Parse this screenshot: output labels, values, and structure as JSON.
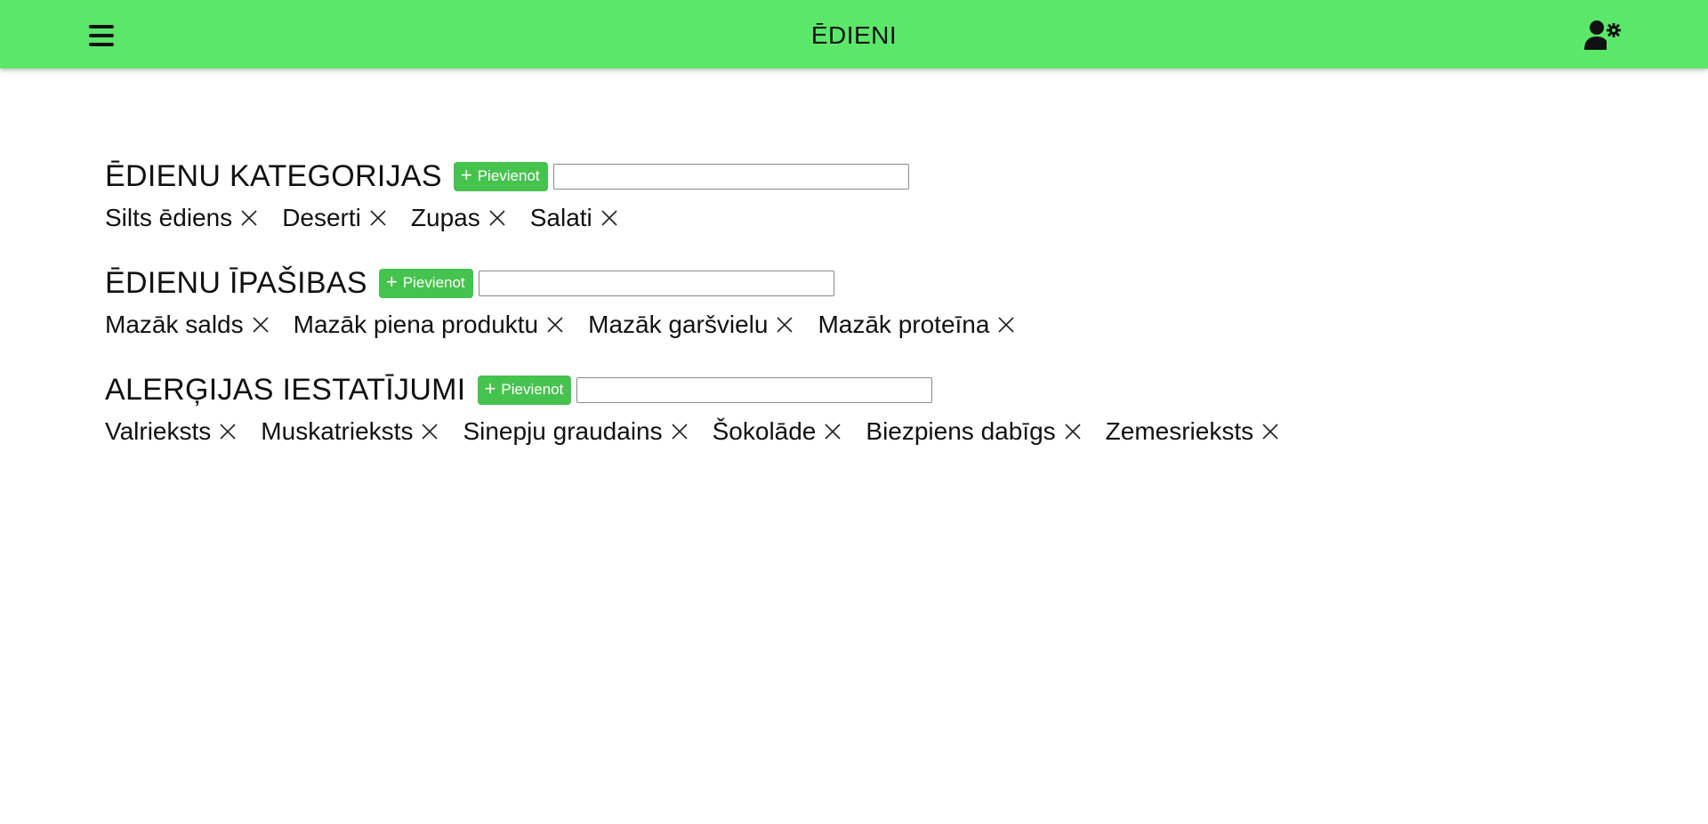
{
  "header": {
    "title": "ĒDIENI",
    "menu_icon": "hamburger-menu-icon",
    "user_icon": "user-settings-icon",
    "background_color": "#5be86a"
  },
  "add_button_label": "Pievienot",
  "sections": [
    {
      "title": "ĒDIENU KATEGORIJAS",
      "input_value": "",
      "tags": [
        "Silts ēdiens",
        "Deserti",
        "Zupas",
        "Salati"
      ]
    },
    {
      "title": "ĒDIENU ĪPAŠIBAS",
      "input_value": "",
      "tags": [
        "Mazāk salds",
        "Mazāk piena produktu",
        "Mazāk garšvielu",
        "Mazāk proteīna"
      ]
    },
    {
      "title": "ALERĢIJAS IESTATĪJUMI",
      "input_value": "",
      "tags": [
        "Valrieksts",
        "Muskatrieksts",
        "Sinepju graudains",
        "Šokolāde",
        "Biezpiens dabīgs",
        "Zemesrieksts"
      ]
    }
  ],
  "colors": {
    "accent": "#46c24f",
    "header": "#5be86a"
  }
}
